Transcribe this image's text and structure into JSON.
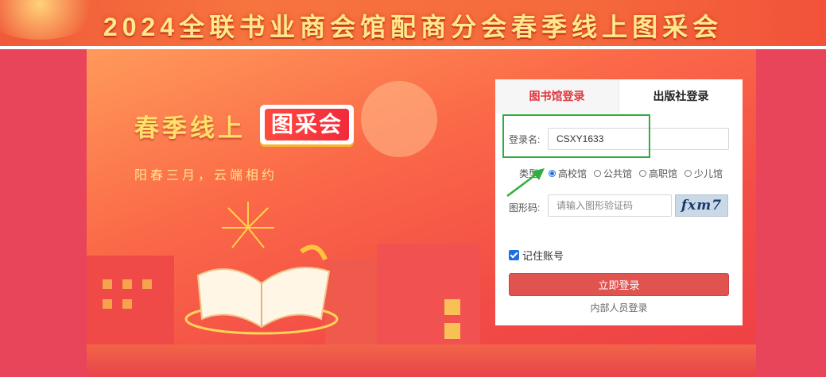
{
  "banner": {
    "title": "2024全联书业商会馆配商分会春季线上图采会"
  },
  "hero": {
    "title": "春季线上",
    "badge": "图采会",
    "subtitle": "阳春三月，云端相约"
  },
  "login": {
    "tabs": [
      {
        "label": "图书馆登录",
        "active": true
      },
      {
        "label": "出版社登录",
        "active": false
      }
    ],
    "username": {
      "label": "登录名:",
      "value": "CSXY1633"
    },
    "type": {
      "label": "类型:",
      "options": [
        {
          "label": "高校馆",
          "selected": true
        },
        {
          "label": "公共馆",
          "selected": false
        },
        {
          "label": "高职馆",
          "selected": false
        },
        {
          "label": "少儿馆",
          "selected": false
        }
      ]
    },
    "captcha": {
      "label": "图形码:",
      "placeholder": "请输入图形验证码",
      "image_text": "fxm7"
    },
    "remember": {
      "label": "记住账号",
      "checked": true
    },
    "submit_label": "立即登录",
    "staff_link": "内部人员登录"
  },
  "colors": {
    "accent": "#e0353c",
    "button": "#e0534f",
    "annotation": "#2fae3c"
  }
}
